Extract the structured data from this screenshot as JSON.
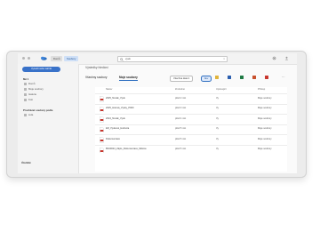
{
  "topbar": {
    "tabs": [
      {
        "label": "Domů"
      },
      {
        "label": "Soubory"
      }
    ],
    "search_value": "vyuk",
    "search_clear": "×"
  },
  "sidebar": {
    "new_button": "Vytvořit nebo nahrát",
    "section_title": "Mé 1",
    "items": [
      {
        "label": "Domů"
      },
      {
        "label": "Moje soubory"
      },
      {
        "label": "Galerie"
      },
      {
        "label": "Koš"
      }
    ],
    "section2_title": "Procházet soubory podle",
    "section2_items": [
      {
        "label": "Lidé"
      }
    ],
    "bottom_label": "Úložiště"
  },
  "main": {
    "breadcrumb": "Výsledky hledání",
    "tabs": [
      {
        "label": "Všechny soubory"
      },
      {
        "label": "Moje soubory"
      }
    ],
    "filter_label": "Všechna data",
    "new_label": "Nov",
    "more": "···",
    "columns": [
      "Název",
      "Změněno",
      "Upravující",
      "Přístup"
    ]
  },
  "files": [
    {
      "name": "2025_Novák_Výuk",
      "modified": "před 2 min",
      "by": "Vy",
      "access": "Moje soubory"
    },
    {
      "name": "2025_Hotová_Výuky_P000",
      "modified": "před 3 min",
      "by": "Vy",
      "access": "Moje soubory"
    },
    {
      "name": "2024_Novák_Výuk",
      "modified": "před 4 min",
      "by": "Vy",
      "access": "Moje soubory"
    },
    {
      "name": "ER_Výuková_Hodnota",
      "modified": "před 5 min",
      "by": "Vy",
      "access": "Moje soubory"
    },
    {
      "name": "Dokumentace",
      "modified": "před 5 min",
      "by": "Vy",
      "access": "Moje soubory"
    },
    {
      "name": "BK20024_Zápis_Dokumentace_Měsíce",
      "modified": "před 5 min",
      "by": "Vy",
      "access": "Moje soubory"
    }
  ],
  "colors": {
    "accent": "#3972c9",
    "pdf": "#c8362d",
    "word": "#2b5faf",
    "excel": "#1f7a44"
  }
}
